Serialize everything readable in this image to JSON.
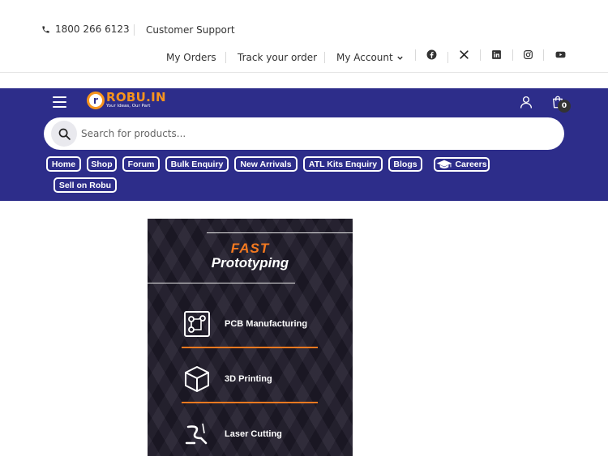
{
  "topbar": {
    "phone": "1800 266 6123",
    "support": "Customer Support",
    "my_orders": "My Orders",
    "track_order": "Track your order",
    "my_account": "My Account",
    "social_icons": [
      "facebook-icon",
      "x-twitter-icon",
      "linkedin-icon",
      "instagram-icon",
      "youtube-icon"
    ]
  },
  "header": {
    "logo_name": "ROBU.IN",
    "logo_letter": "r",
    "logo_tagline": "Your Ideas, Our Part",
    "cart_count": "0",
    "brand_color": "#2d2d8a",
    "accent_color": "#f7941d"
  },
  "search": {
    "placeholder": "Search for products..."
  },
  "nav": {
    "items": [
      "Home",
      "Shop",
      "Forum",
      "Bulk Enquiry",
      "New Arrivals",
      "ATL Kits Enquiry",
      "Blogs"
    ],
    "careers": "Careers",
    "sell": "Sell on Robu"
  },
  "banner": {
    "headline": "FAST",
    "subheadline": "Prototyping",
    "services": [
      {
        "label": "PCB Manufacturing",
        "icon": "pcb-icon"
      },
      {
        "label": "3D Printing",
        "icon": "cube-icon"
      },
      {
        "label": "Laser Cutting",
        "icon": "laser-icon"
      }
    ],
    "highlight_color": "#f47920"
  }
}
